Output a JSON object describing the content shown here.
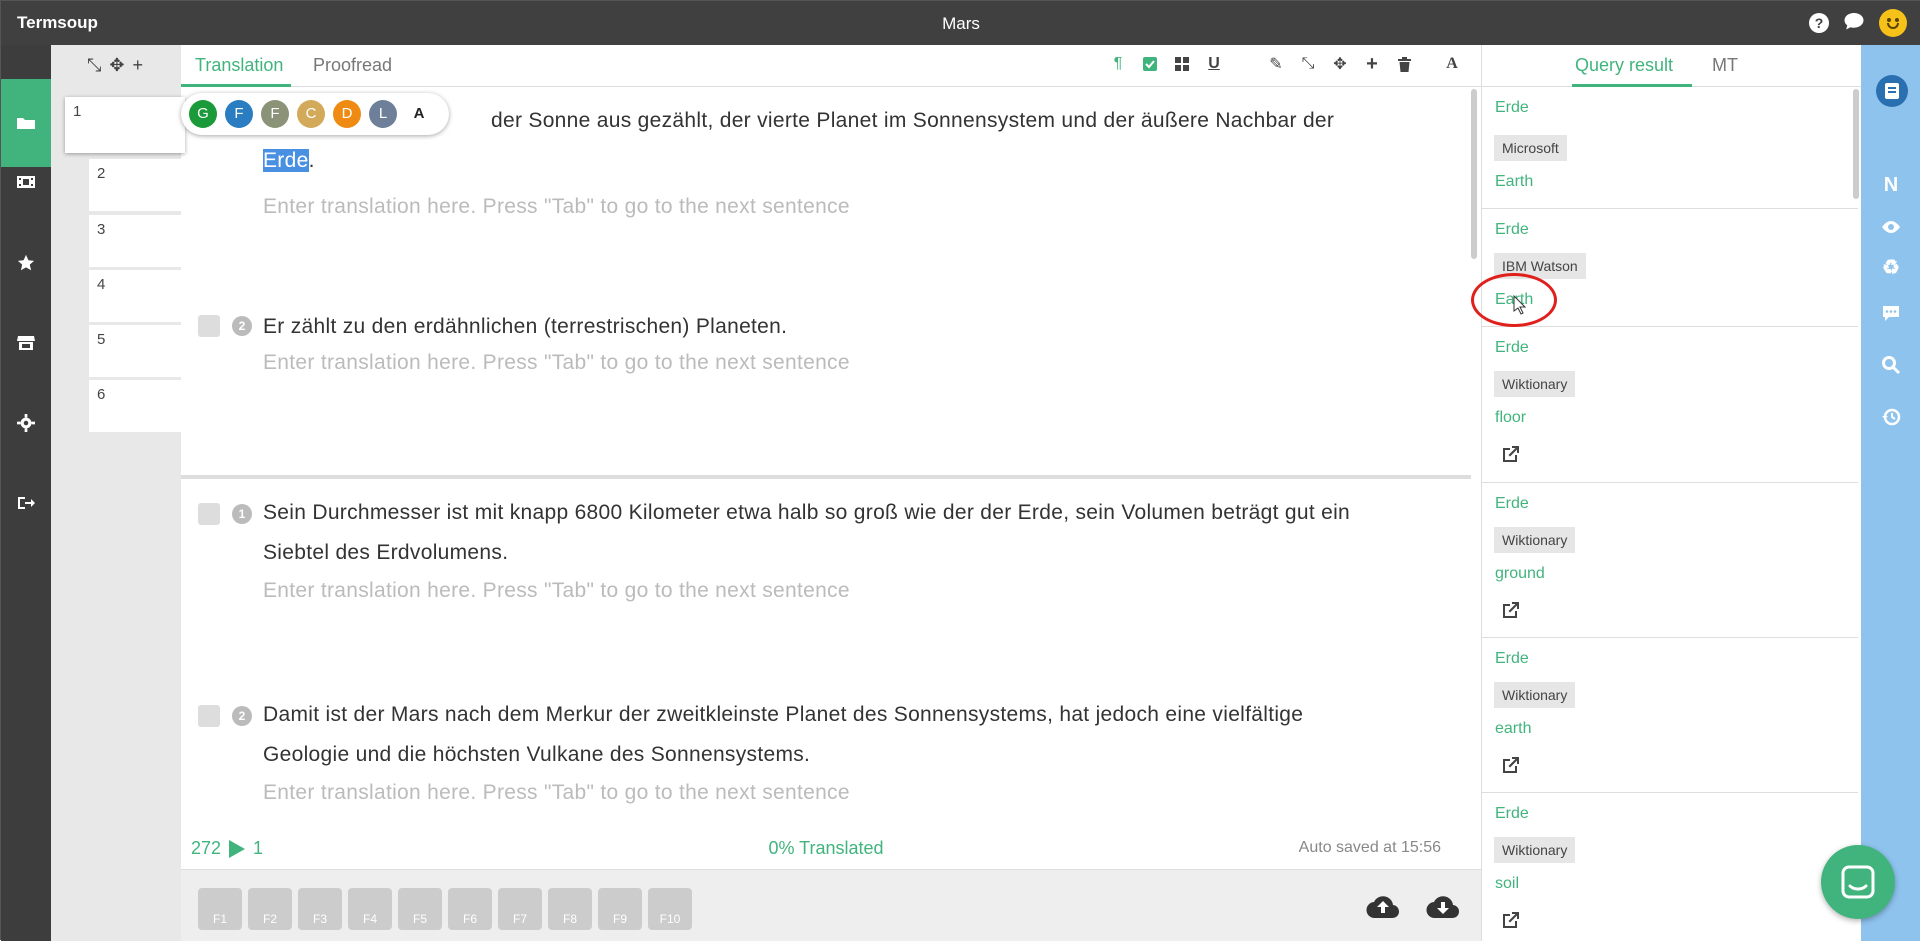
{
  "app": {
    "name": "Termsoup",
    "doc_title": "Mars"
  },
  "titlebar_icons": [
    "help-icon",
    "chat-icon",
    "smiley-icon"
  ],
  "rail": [
    "folder-icon",
    "film-icon",
    "star-icon",
    "store-icon",
    "gear-icon",
    "logout-icon"
  ],
  "segments": {
    "numbers": [
      "1",
      "2",
      "3",
      "4",
      "5",
      "6"
    ]
  },
  "editor": {
    "tabs": [
      "Translation",
      "Proofread"
    ],
    "toolbar": [
      "pilcrow-icon",
      "checkbox-icon",
      "grid-icon",
      "underline-icon",
      "pencil-icon",
      "compress-icon",
      "move-icon",
      "plus-icon",
      "trash-icon",
      "font-icon"
    ],
    "lang_options": [
      {
        "label": "G",
        "color": "#1a9a39"
      },
      {
        "label": "F",
        "color": "#2a7dc0"
      },
      {
        "label": "F",
        "color": "#8a9277"
      },
      {
        "label": "C",
        "color": "#d3aa5a"
      },
      {
        "label": "D",
        "color": "#ef8a12"
      },
      {
        "label": "L",
        "color": "#6e8099"
      },
      {
        "label": "A",
        "color": "#ffffff"
      }
    ],
    "rows": [
      {
        "badge": "",
        "src_pre": "der Sonne aus gezählt, der vierte Planet im Sonnensystem und der äußere Nachbar der",
        "src_hl": "Erde",
        "src_post": ".",
        "tgt": "Enter translation here. Press \"Tab\" to go to the next sentence"
      },
      {
        "badge": "2",
        "src": "Er zählt zu den erdähnlichen (terrestrischen) Planeten.",
        "tgt": "Enter translation here. Press \"Tab\" to go to the next sentence"
      },
      {
        "badge": "1",
        "src": "Sein Durchmesser ist mit knapp 6800 Kilometer etwa halb so groß wie der der Erde, sein Volumen beträgt gut ein Siebtel des Erdvolumens.",
        "tgt": "Enter translation here. Press \"Tab\" to go to the next sentence"
      },
      {
        "badge": "2",
        "src": "Damit ist der Mars nach dem Merkur der zweitkleinste Planet des Sonnensystems, hat jedoch eine vielfältige Geologie und die höchsten Vulkane des Sonnensystems.",
        "tgt": "Enter translation here. Press \"Tab\" to go to the next sentence"
      }
    ],
    "status": {
      "word_count": "272",
      "segment_index": "1",
      "translated": "0% Translated",
      "saved": "Auto saved at 15:56"
    },
    "fkeys": [
      "F1",
      "F2",
      "F3",
      "F4",
      "F5",
      "F6",
      "F7",
      "F8",
      "F9",
      "F10"
    ]
  },
  "panel": {
    "tabs": [
      "Query result",
      "MT"
    ],
    "results": [
      {
        "src": "Erde",
        "provider": "Microsoft",
        "tgt": "Earth",
        "link": false
      },
      {
        "src": "Erde",
        "provider": "IBM Watson",
        "tgt": "Earth",
        "link": false
      },
      {
        "src": "Erde",
        "provider": "Wiktionary",
        "tgt": "floor",
        "link": true
      },
      {
        "src": "Erde",
        "provider": "Wiktionary",
        "tgt": "ground",
        "link": true
      },
      {
        "src": "Erde",
        "provider": "Wiktionary",
        "tgt": "earth",
        "link": true
      },
      {
        "src": "Erde",
        "provider": "Wiktionary",
        "tgt": "soil",
        "link": true
      }
    ]
  },
  "right_rail": [
    "notebook-icon",
    "n-icon",
    "eye-icon",
    "recycle-icon",
    "comment-icon",
    "search-icon",
    "history-icon"
  ],
  "right_rail_label": "N",
  "colors": {
    "accent": "#41b47d",
    "titlebar": "#404040",
    "rail": "#3d3d3d",
    "right_rail": "#8ec3ee",
    "highlight": "#4a90e2",
    "annotation": "#e0201b"
  }
}
